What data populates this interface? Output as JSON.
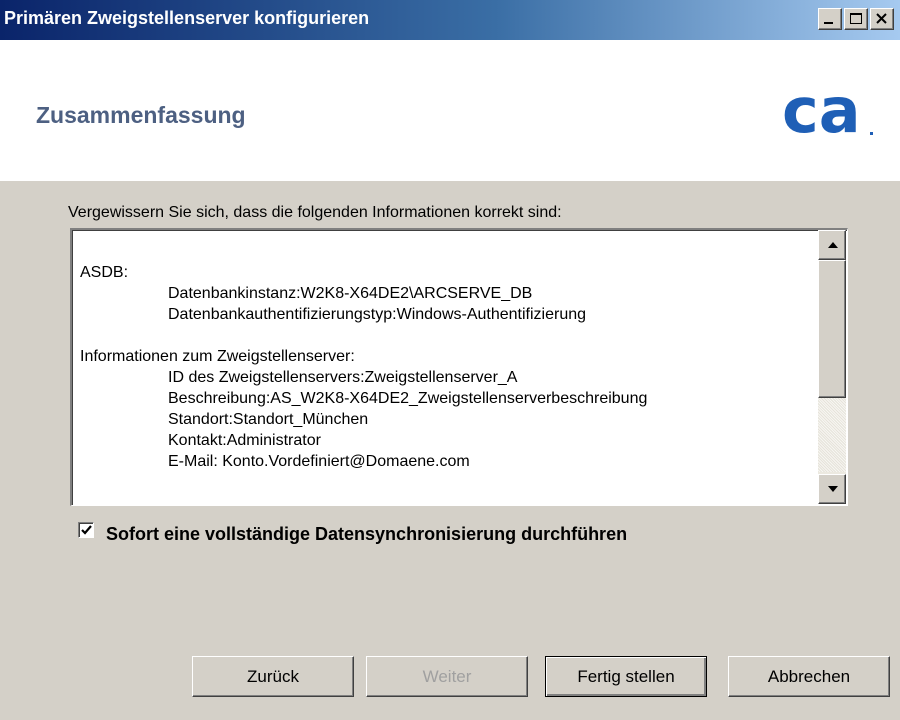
{
  "window": {
    "title": "Primären Zweigstellenserver konfigurieren"
  },
  "header": {
    "title": "Zusammenfassung",
    "logo_text": "ca",
    "logo_color": "#1f5fb6"
  },
  "main": {
    "prompt": "Vergewissern Sie sich, dass die folgenden Informationen korrekt sind:",
    "summary": {
      "lines": [
        "ASDB:",
        "Datenbankinstanz:W2K8-X64DE2\\ARCSERVE_DB",
        "Datenbankauthentifizierungstyp:Windows-Authentifizierung",
        "Informationen zum Zweigstellenserver:",
        "ID des Zweigstellenservers:Zweigstellenserver_A",
        "Beschreibung:AS_W2K8-X64DE2_Zweigstellenserverbeschreibung",
        "Standort:Standort_München",
        "Kontakt:Administrator",
        "E-Mail: Konto.Vordefiniert@Domaene.com"
      ]
    },
    "sync_checkbox": {
      "label": "Sofort eine vollständige Datensynchronisierung durchführen",
      "checked": true
    }
  },
  "buttons": {
    "back": "Zurück",
    "next": "Weiter",
    "finish": "Fertig stellen",
    "cancel": "Abbrechen"
  }
}
